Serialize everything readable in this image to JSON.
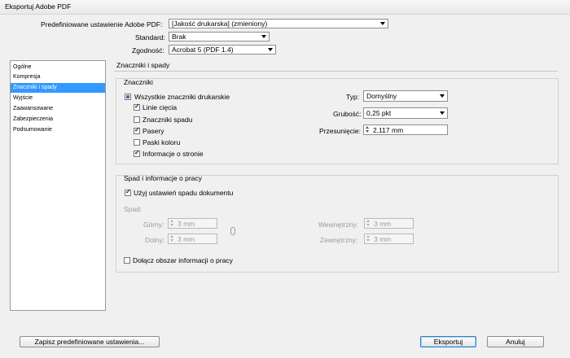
{
  "window": {
    "title": "Eksportuj Adobe PDF"
  },
  "top": {
    "preset_label": "Predefiniowane ustawienie Adobe PDF:",
    "preset_value": "[Jakość drukarska] (zmieniony)",
    "standard_label": "Standard:",
    "standard_value": "Brak",
    "compat_label": "Zgodność:",
    "compat_value": "Acrobat 5 (PDF 1.4)"
  },
  "sidebar": {
    "items": [
      {
        "label": "Ogólne"
      },
      {
        "label": "Kompresja"
      },
      {
        "label": "Znaczniki i spady"
      },
      {
        "label": "Wyjście"
      },
      {
        "label": "Zaawansowane"
      },
      {
        "label": "Zabezpieczenia"
      },
      {
        "label": "Podsumowanie"
      }
    ],
    "selected_index": 2
  },
  "panel": {
    "title": "Znaczniki i spady",
    "marks": {
      "group_title": "Znaczniki",
      "all_marks": "Wszystkie znaczniki drukarskie",
      "crop": "Linie cięcia",
      "bleed_marks": "Znaczniki spadu",
      "registration": "Pasery",
      "color_bars": "Paski koloru",
      "page_info": "Informacje o stronie",
      "type_label": "Typ:",
      "type_value": "Domyślny",
      "weight_label": "Grubość:",
      "weight_value": "0,25 pkt",
      "offset_label": "Przesunięcie:",
      "offset_value": "2,117 mm"
    },
    "bleed": {
      "group_title": "Spad i informacje o pracy",
      "use_doc_bleed": "Użyj ustawień spadu dokumentu",
      "bleed_label": "Spad:",
      "top_label": "Górny:",
      "top_value": "3 mm",
      "bottom_label": "Dolny:",
      "bottom_value": "3 mm",
      "inside_label": "Wewnętrzny:",
      "inside_value": "3 mm",
      "outside_label": "Zewnętrzny:",
      "outside_value": "3 mm",
      "slug": "Dołącz obszar informacji o pracy"
    }
  },
  "buttons": {
    "save_preset": "Zapisz predefiniowane ustawienia...",
    "export": "Eksportuj",
    "cancel": "Anuluj"
  }
}
